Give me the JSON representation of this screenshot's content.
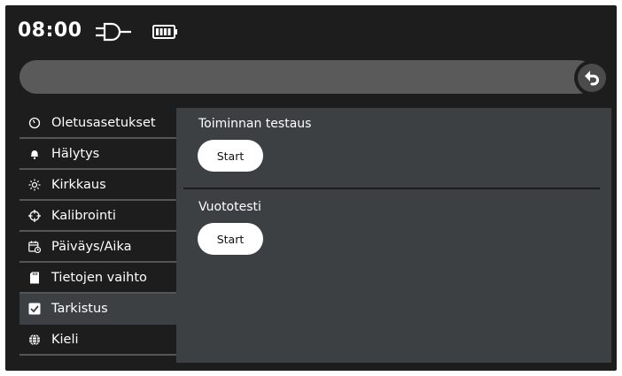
{
  "status": {
    "time": "08:00",
    "icons": [
      "plug-icon",
      "battery-icon"
    ]
  },
  "header": {
    "title": "",
    "back_icon": "back-arrow-icon"
  },
  "sidebar": {
    "items": [
      {
        "label": "Oletusasetukset",
        "icon": "gauge-icon",
        "active": false
      },
      {
        "label": "Hälytys",
        "icon": "bell-icon",
        "active": false
      },
      {
        "label": "Kirkkaus",
        "icon": "sun-icon",
        "active": false
      },
      {
        "label": "Kalibrointi",
        "icon": "crosshair-icon",
        "active": false
      },
      {
        "label": "Päiväys/Aika",
        "icon": "calendar-clock-icon",
        "active": false
      },
      {
        "label": "Tietojen vaihto",
        "icon": "sd-card-icon",
        "active": false
      },
      {
        "label": "Tarkistus",
        "icon": "checkbox-icon",
        "active": true
      },
      {
        "label": "Kieli",
        "icon": "globe-icon",
        "active": false
      }
    ]
  },
  "main": {
    "sections": [
      {
        "title": "Toiminnan testaus",
        "button_label": "Start"
      },
      {
        "title": "Vuototesti",
        "button_label": "Start"
      }
    ]
  },
  "colors": {
    "background": "#1d1d1d",
    "panel": "#3c4042",
    "title_bar": "#5a5a5a",
    "text": "#ffffff"
  }
}
